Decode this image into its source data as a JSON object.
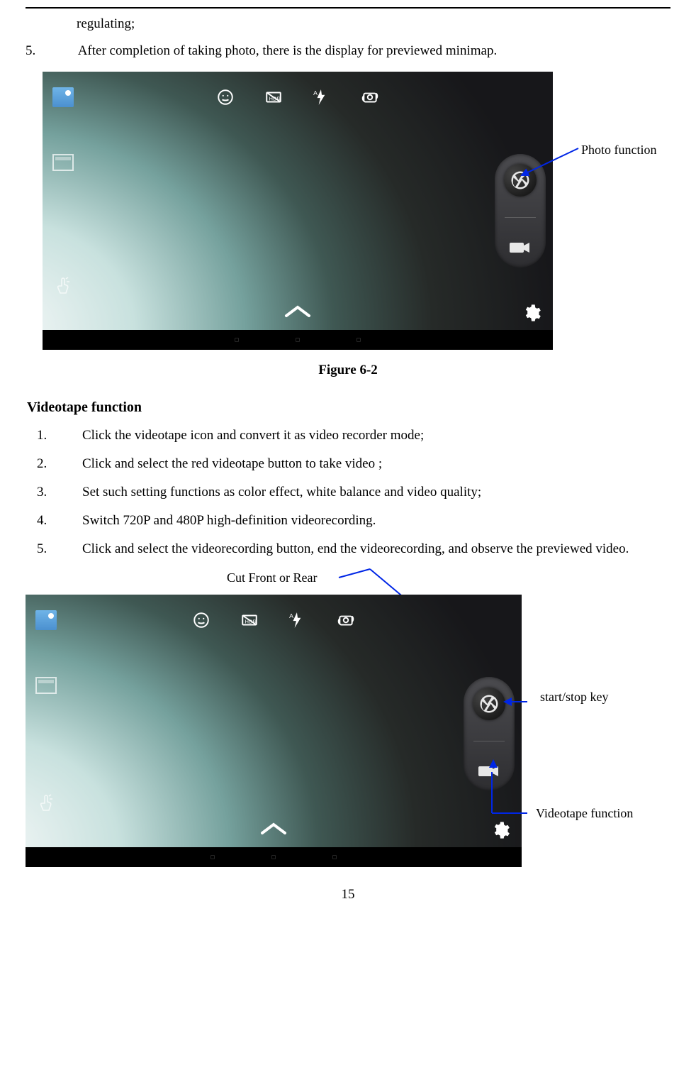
{
  "top_text": "regulating;",
  "item5_num": "5.",
  "item5_text": "After completion of taking photo, there is the display for previewed minimap.",
  "figure_caption": "Figure 6-2",
  "callout_photo": "Photo function",
  "section_title": "Videotape function",
  "vitems": [
    {
      "num": "1.",
      "text": "Click the videotape icon and convert it as video recorder mode;"
    },
    {
      "num": "2.",
      "text": "Click and select the red videotape button to take video ;"
    },
    {
      "num": "3.",
      "text": "Set such setting functions as color effect, white balance and video quality;"
    },
    {
      "num": "4.",
      "text": "Switch 720P and 480P high-definition videorecording."
    },
    {
      "num": "5.",
      "text": "Click and select the videorecording button, end the videorecording, and observe the previewed video."
    }
  ],
  "callout_cut": "Cut Front or Rear",
  "callout_start": "start/stop key",
  "callout_video": "Videotape function",
  "page_number": "15",
  "icons": {
    "thumb": "gallery-thumbnail-icon",
    "face": "face-icon",
    "hdr": "hdr-icon",
    "flash": "flash-auto-icon",
    "switchcam": "switch-camera-icon",
    "box": "aspect-ratio-icon",
    "gesture": "gesture-icon",
    "chevron": "chevron-up-icon",
    "gear": "settings-gear-icon",
    "shutter": "shutter-icon",
    "camcorder": "camcorder-icon"
  }
}
